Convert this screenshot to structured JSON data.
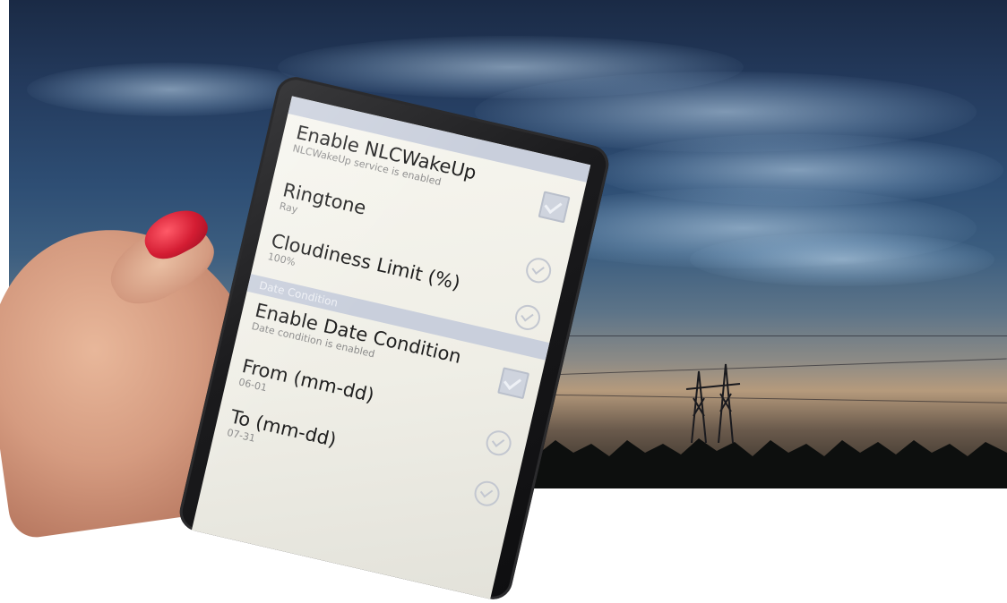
{
  "screen": {
    "top_header": "",
    "prefs_main": [
      {
        "title": "Enable NLCWakeUp",
        "summary": "NLCWakeUp service is enabled",
        "control": "checkbox-checked"
      },
      {
        "title": "Ringtone",
        "summary": "Ray",
        "control": "chevron-circle"
      },
      {
        "title": "Cloudiness Limit (%)",
        "summary": "100%",
        "control": "chevron-circle"
      }
    ],
    "section_date": "Date Condition",
    "prefs_date": [
      {
        "title": "Enable Date Condition",
        "summary": "Date condition is enabled",
        "control": "checkbox-checked"
      },
      {
        "title": "From (mm-dd)",
        "summary": "06-01",
        "control": "chevron-circle"
      },
      {
        "title": "To (mm-dd)",
        "summary": "07-31",
        "control": "chevron-circle"
      }
    ]
  },
  "colors": {
    "sky_top": "#1a2a45",
    "horizon": "#b59a7c",
    "nail": "#d41d33",
    "section_header": "#c9cfdc"
  }
}
